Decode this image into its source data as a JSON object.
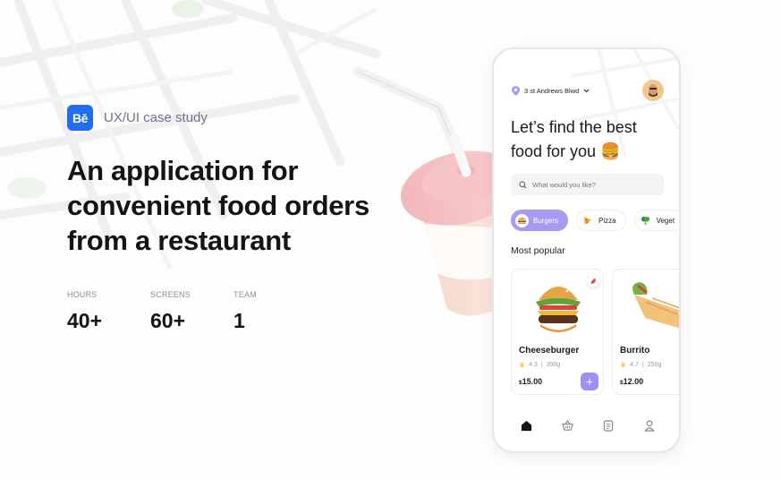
{
  "badge": {
    "logo_text": "Bē",
    "label": "UX/UI case study",
    "brand_color": "#1f6ef0"
  },
  "headline": {
    "line1": "An application for",
    "line2": "convenient food orders",
    "line3": "from a restaurant"
  },
  "stats": [
    {
      "label": "HOURS",
      "value": "40+"
    },
    {
      "label": "SCREENS",
      "value": "60+"
    },
    {
      "label": "TEAM",
      "value": "1"
    }
  ],
  "app": {
    "location": "3 st Andrews Blwd",
    "title_line1": "Let’s find the best",
    "title_line2": "food for you 🍔",
    "search_placeholder": "What would you like?",
    "accent_color": "#a79af3",
    "categories": [
      {
        "label": "Burgers",
        "icon": "burger-icon",
        "active": true
      },
      {
        "label": "Pizza",
        "icon": "pizza-icon",
        "active": false
      },
      {
        "label": "Veget",
        "icon": "broccoli-icon",
        "active": false
      }
    ],
    "section_title": "Most popular",
    "items": [
      {
        "name": "Cheeseburger",
        "rating": "4.3",
        "weight": "390g",
        "currency": "$",
        "price": "15.00",
        "icon": "cheeseburger-image"
      },
      {
        "name": "Burrito",
        "rating": "4.7",
        "weight": "250g",
        "currency": "$",
        "price": "12.00",
        "icon": "burrito-image"
      }
    ],
    "nav": [
      "home-icon",
      "basket-icon",
      "orders-icon",
      "profile-icon"
    ]
  }
}
